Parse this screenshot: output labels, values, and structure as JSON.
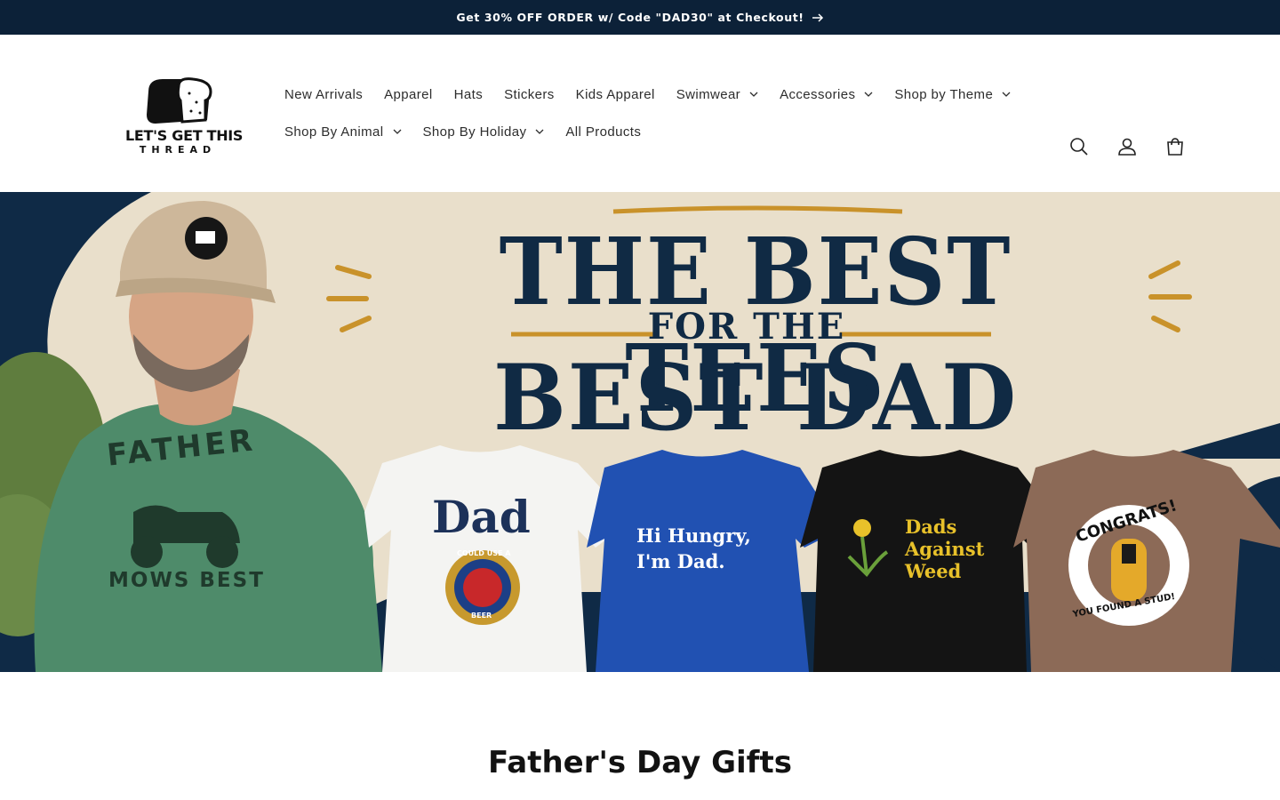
{
  "announcement": {
    "text": "Get 30% OFF ORDER w/ Code \"DAD30\" at Checkout!"
  },
  "brand": {
    "line1": "LET'S GET THIS",
    "line2": "THREAD"
  },
  "nav": {
    "row1": [
      {
        "label": "New Arrivals",
        "dropdown": false
      },
      {
        "label": "Apparel",
        "dropdown": false
      },
      {
        "label": "Hats",
        "dropdown": false
      },
      {
        "label": "Stickers",
        "dropdown": false
      },
      {
        "label": "Kids Apparel",
        "dropdown": false
      },
      {
        "label": "Swimwear",
        "dropdown": true
      },
      {
        "label": "Accessories",
        "dropdown": true
      },
      {
        "label": "Shop by Theme",
        "dropdown": true
      }
    ],
    "row2": [
      {
        "label": "Shop By Animal",
        "dropdown": true
      },
      {
        "label": "Shop By Holiday",
        "dropdown": true
      },
      {
        "label": "All Products",
        "dropdown": false
      }
    ]
  },
  "header_icons": [
    "search-icon",
    "account-icon",
    "cart-icon"
  ],
  "hero": {
    "title_line1": "THE BEST TEES",
    "title_line2": "FOR THE",
    "title_line3": "BEST DAD",
    "shirts": {
      "green_top": "FATHER",
      "green_bottom": "MOWS BEST",
      "white": "Dad",
      "white_badge_top": "COULD USE A",
      "white_badge_bottom": "BEER",
      "blue_line1": "Hi Hungry,",
      "blue_line2": "I'm Dad.",
      "black_line1": "Dads",
      "black_line2": "Against",
      "black_line3": "Weed",
      "brown_top": "CONGRATS!",
      "brown_bottom": "YOU FOUND A STUD!"
    }
  },
  "section": {
    "title": "Father's Day Gifts"
  },
  "colors": {
    "announcement_bg": "#0c2138",
    "hero_navy": "#102a44",
    "accent_gold": "#c9922a"
  }
}
